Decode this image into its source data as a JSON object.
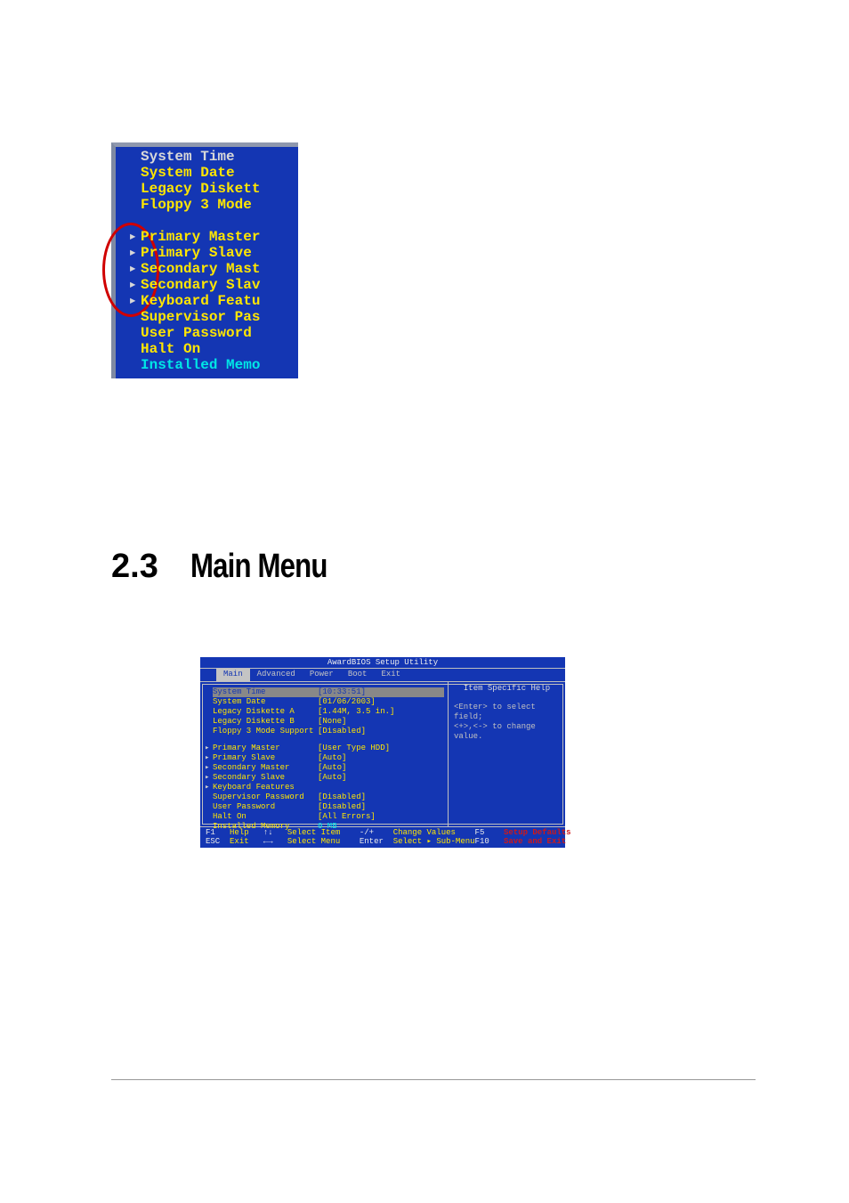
{
  "topCrop": {
    "group1": [
      "System Time",
      "System Date",
      "Legacy Diskett",
      "Floppy 3 Mode"
    ],
    "group2": [
      {
        "arrow": true,
        "text": "Primary Master",
        "color": "hl"
      },
      {
        "arrow": true,
        "text": "Primary Slave",
        "color": "hl"
      },
      {
        "arrow": true,
        "text": "Secondary Mast",
        "color": "hl"
      },
      {
        "arrow": true,
        "text": "Secondary Slav",
        "color": "hl"
      },
      {
        "arrow": true,
        "text": "Keyboard Featu",
        "color": "hl"
      },
      {
        "arrow": false,
        "text": "Supervisor Pas",
        "color": "hl"
      },
      {
        "arrow": false,
        "text": "User Password",
        "color": "hl"
      },
      {
        "arrow": false,
        "text": "Halt On",
        "color": "hl"
      },
      {
        "arrow": false,
        "text": "Installed Memo",
        "color": "cy"
      }
    ]
  },
  "heading": {
    "num": "2.3",
    "title": "Main Menu"
  },
  "bios": {
    "title": "AwardBIOS Setup Utility",
    "tabs": [
      "Main",
      "Advanced",
      "Power",
      "Boot",
      "Exit"
    ],
    "activeTab": 0,
    "fields": [
      {
        "label": "System Time",
        "value": "[10:33:51]",
        "selected": true
      },
      {
        "label": "System Date",
        "value": "[01/06/2003]"
      },
      {
        "label": "Legacy Diskette A",
        "value": "[1.44M, 3.5 in.]"
      },
      {
        "label": "Legacy Diskette B",
        "value": "[None]"
      },
      {
        "label": "Floppy 3 Mode Support",
        "value": "[Disabled]"
      },
      {
        "spacer": true
      },
      {
        "label": "Primary Master",
        "value": "[User Type HDD]",
        "arrow": true
      },
      {
        "label": "Primary Slave",
        "value": "[Auto]",
        "arrow": true
      },
      {
        "label": "Secondary Master",
        "value": "[Auto]",
        "arrow": true
      },
      {
        "label": "Secondary Slave",
        "value": "[Auto]",
        "arrow": true
      },
      {
        "label": "Keyboard Features",
        "value": "",
        "arrow": true
      },
      {
        "label": "Supervisor Password",
        "value": "[Disabled]"
      },
      {
        "label": "User Password",
        "value": "[Disabled]"
      },
      {
        "label": "Halt On",
        "value": "[All Errors]"
      },
      {
        "label": "Installed Memory",
        "value": "0 MB",
        "mem": true
      }
    ],
    "help": {
      "heading": "Item Specific Help",
      "l1": "<Enter> to select field;",
      "l2": "<+>,<-> to change value."
    },
    "footer": {
      "f1": "F1",
      "help": "Help",
      "arrowsV": "↑↓",
      "selectItem": "Select Item",
      "pm": "-/+",
      "changeValues": "Change Values",
      "f5": "F5",
      "setupDefaults": "Setup Defaults",
      "esc": "ESC",
      "exit": "Exit",
      "arrowsH": "←→",
      "selectMenu": "Select Menu",
      "enter": "Enter",
      "selectSubMenu": "Select ▸ Sub-Menu",
      "f10": "F10",
      "saveAndExit": "Save and Exit"
    }
  }
}
